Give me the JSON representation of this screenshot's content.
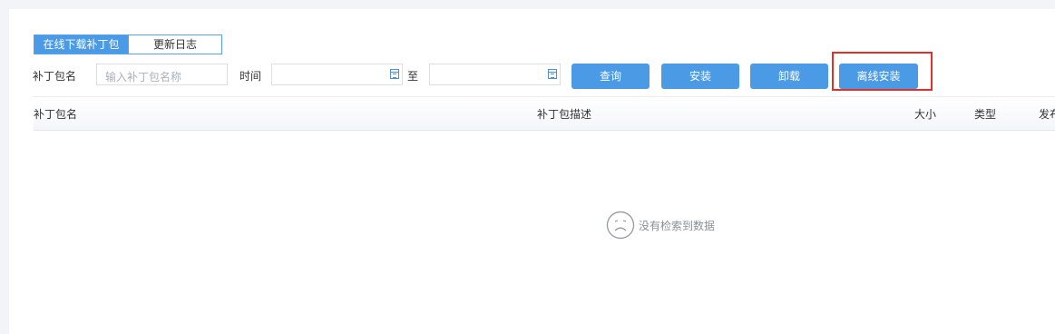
{
  "tabs": [
    {
      "label": "在线下载补丁包",
      "active": true
    },
    {
      "label": "更新日志",
      "active": false
    }
  ],
  "filters": {
    "name_label": "补丁包名",
    "name_placeholder": "输入补丁包名称",
    "time_label": "时间",
    "range_sep": "至",
    "start_date": "",
    "end_date": ""
  },
  "buttons": {
    "query": "查询",
    "install": "安装",
    "uninstall": "卸载",
    "offline_install": "离线安装"
  },
  "table": {
    "columns": [
      "补丁包名",
      "补丁包描述",
      "大小",
      "类型",
      "发布"
    ],
    "rows": [],
    "empty_text": "没有检索到数据"
  },
  "colors": {
    "primary": "#4a9ae6",
    "highlight_border": "#e0302a",
    "background": "#f2f4f7"
  },
  "icons": {
    "calendar": "calendar-icon",
    "empty": "sad-face-icon"
  }
}
